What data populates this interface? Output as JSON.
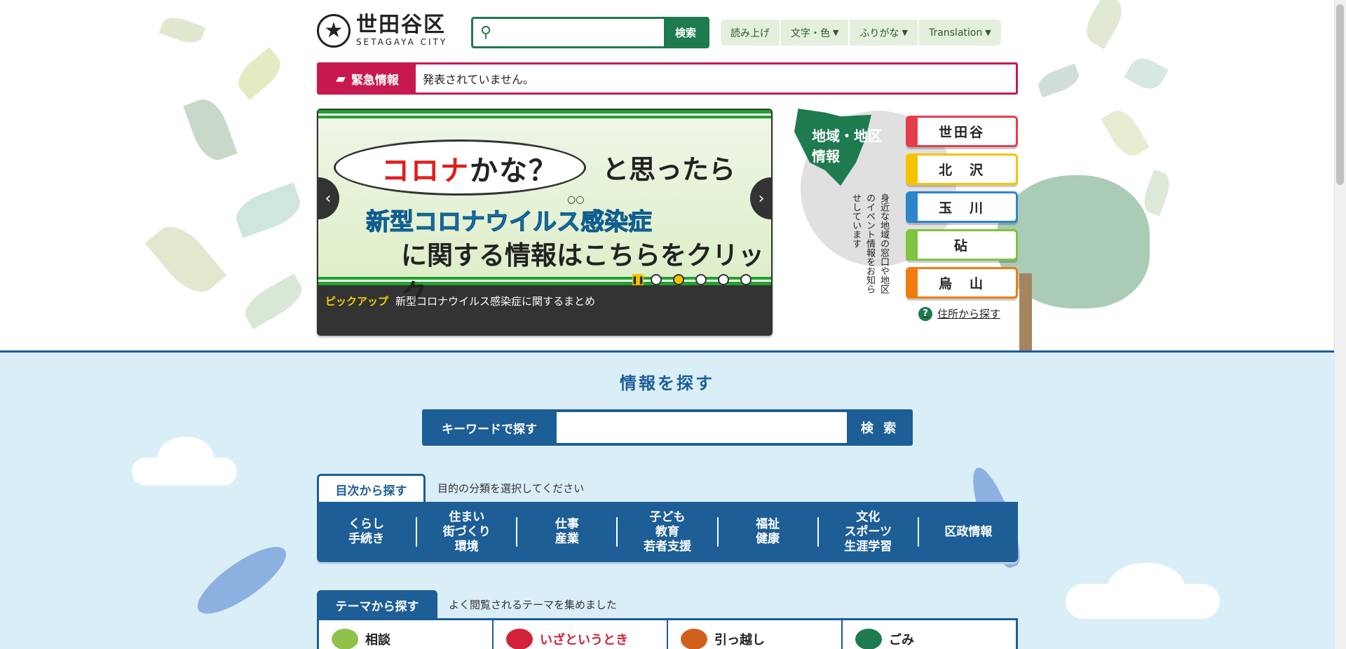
{
  "header": {
    "logo_ja": "世田谷区",
    "logo_en": "SETAGAYA CITY",
    "search_button": "検索",
    "tools": [
      {
        "label": "読み上げ",
        "chevron": false
      },
      {
        "label": "文字・色",
        "chevron": true
      },
      {
        "label": "ふりがな",
        "chevron": true
      },
      {
        "label": "Translation",
        "chevron": true
      }
    ]
  },
  "emergency": {
    "label": "緊急情報",
    "message": "発表されていません。"
  },
  "carousel": {
    "banner_red": "コロナ",
    "banner_line1": "かな？",
    "banner_line1b": "と思ったら",
    "banner_line2": "新型コロナウイルス感染症",
    "banner_line3": "に関する情報はこちらをクリック",
    "pickup_label": "ピックアップ",
    "pickup_text": "新型コロナウイルス感染症に関するまとめ",
    "dots_count": 5,
    "active_dot": 1
  },
  "region": {
    "title_line1": "地域・地区",
    "title_line2": "情報",
    "description": "身近な地域の窓口や地区のイベント情報をお知らせしています",
    "buttons": [
      {
        "label": "世田谷",
        "color": "#e53e4b"
      },
      {
        "label": "北　沢",
        "color": "#f5c400"
      },
      {
        "label": "玉　川",
        "color": "#2b86cc"
      },
      {
        "label": "砧",
        "color": "#80c241"
      },
      {
        "label": "烏　山",
        "color": "#f07c10"
      }
    ],
    "address_link": "住所から探す"
  },
  "find": {
    "title": "情報を探す",
    "keyword_label": "キーワードで探す",
    "keyword_button": "検 索"
  },
  "toc": {
    "tab": "目次から探す",
    "note": "目的の分類を選択してください",
    "categories": [
      "くらし\n手続き",
      "住まい\n街づくり\n環境",
      "仕事\n産業",
      "子ども\n教育\n若者支援",
      "福祉\n健康",
      "文化\nスポーツ\n生涯学習",
      "区政情報"
    ]
  },
  "themes": {
    "tab": "テーマから探す",
    "note": "よく閲覧されるテーマを集めました",
    "items": [
      {
        "label": "相談",
        "color": "#8fc24a"
      },
      {
        "label": "いざというとき",
        "color": "#d2233b"
      },
      {
        "label": "引っ越し",
        "color": "#d0601e"
      },
      {
        "label": "ごみ",
        "color": "#1e7a4f"
      }
    ]
  },
  "colors": {
    "accent_green": "#1e7a4f",
    "emergency_red": "#c8194e",
    "navy": "#1d5e96",
    "lower_bg": "#daeef8"
  }
}
